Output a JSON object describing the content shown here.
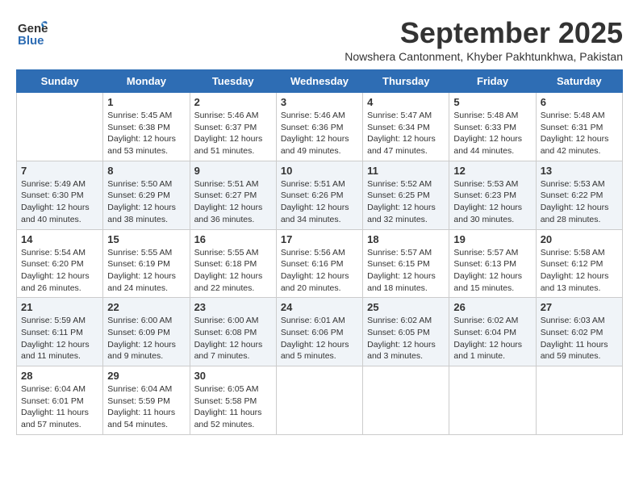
{
  "header": {
    "logo_line1": "General",
    "logo_line2": "Blue",
    "month": "September 2025",
    "location": "Nowshera Cantonment, Khyber Pakhtunkhwa, Pakistan"
  },
  "weekdays": [
    "Sunday",
    "Monday",
    "Tuesday",
    "Wednesday",
    "Thursday",
    "Friday",
    "Saturday"
  ],
  "weeks": [
    [
      {
        "day": "",
        "info": ""
      },
      {
        "day": "1",
        "info": "Sunrise: 5:45 AM\nSunset: 6:38 PM\nDaylight: 12 hours\nand 53 minutes."
      },
      {
        "day": "2",
        "info": "Sunrise: 5:46 AM\nSunset: 6:37 PM\nDaylight: 12 hours\nand 51 minutes."
      },
      {
        "day": "3",
        "info": "Sunrise: 5:46 AM\nSunset: 6:36 PM\nDaylight: 12 hours\nand 49 minutes."
      },
      {
        "day": "4",
        "info": "Sunrise: 5:47 AM\nSunset: 6:34 PM\nDaylight: 12 hours\nand 47 minutes."
      },
      {
        "day": "5",
        "info": "Sunrise: 5:48 AM\nSunset: 6:33 PM\nDaylight: 12 hours\nand 44 minutes."
      },
      {
        "day": "6",
        "info": "Sunrise: 5:48 AM\nSunset: 6:31 PM\nDaylight: 12 hours\nand 42 minutes."
      }
    ],
    [
      {
        "day": "7",
        "info": "Sunrise: 5:49 AM\nSunset: 6:30 PM\nDaylight: 12 hours\nand 40 minutes."
      },
      {
        "day": "8",
        "info": "Sunrise: 5:50 AM\nSunset: 6:29 PM\nDaylight: 12 hours\nand 38 minutes."
      },
      {
        "day": "9",
        "info": "Sunrise: 5:51 AM\nSunset: 6:27 PM\nDaylight: 12 hours\nand 36 minutes."
      },
      {
        "day": "10",
        "info": "Sunrise: 5:51 AM\nSunset: 6:26 PM\nDaylight: 12 hours\nand 34 minutes."
      },
      {
        "day": "11",
        "info": "Sunrise: 5:52 AM\nSunset: 6:25 PM\nDaylight: 12 hours\nand 32 minutes."
      },
      {
        "day": "12",
        "info": "Sunrise: 5:53 AM\nSunset: 6:23 PM\nDaylight: 12 hours\nand 30 minutes."
      },
      {
        "day": "13",
        "info": "Sunrise: 5:53 AM\nSunset: 6:22 PM\nDaylight: 12 hours\nand 28 minutes."
      }
    ],
    [
      {
        "day": "14",
        "info": "Sunrise: 5:54 AM\nSunset: 6:20 PM\nDaylight: 12 hours\nand 26 minutes."
      },
      {
        "day": "15",
        "info": "Sunrise: 5:55 AM\nSunset: 6:19 PM\nDaylight: 12 hours\nand 24 minutes."
      },
      {
        "day": "16",
        "info": "Sunrise: 5:55 AM\nSunset: 6:18 PM\nDaylight: 12 hours\nand 22 minutes."
      },
      {
        "day": "17",
        "info": "Sunrise: 5:56 AM\nSunset: 6:16 PM\nDaylight: 12 hours\nand 20 minutes."
      },
      {
        "day": "18",
        "info": "Sunrise: 5:57 AM\nSunset: 6:15 PM\nDaylight: 12 hours\nand 18 minutes."
      },
      {
        "day": "19",
        "info": "Sunrise: 5:57 AM\nSunset: 6:13 PM\nDaylight: 12 hours\nand 15 minutes."
      },
      {
        "day": "20",
        "info": "Sunrise: 5:58 AM\nSunset: 6:12 PM\nDaylight: 12 hours\nand 13 minutes."
      }
    ],
    [
      {
        "day": "21",
        "info": "Sunrise: 5:59 AM\nSunset: 6:11 PM\nDaylight: 12 hours\nand 11 minutes."
      },
      {
        "day": "22",
        "info": "Sunrise: 6:00 AM\nSunset: 6:09 PM\nDaylight: 12 hours\nand 9 minutes."
      },
      {
        "day": "23",
        "info": "Sunrise: 6:00 AM\nSunset: 6:08 PM\nDaylight: 12 hours\nand 7 minutes."
      },
      {
        "day": "24",
        "info": "Sunrise: 6:01 AM\nSunset: 6:06 PM\nDaylight: 12 hours\nand 5 minutes."
      },
      {
        "day": "25",
        "info": "Sunrise: 6:02 AM\nSunset: 6:05 PM\nDaylight: 12 hours\nand 3 minutes."
      },
      {
        "day": "26",
        "info": "Sunrise: 6:02 AM\nSunset: 6:04 PM\nDaylight: 12 hours\nand 1 minute."
      },
      {
        "day": "27",
        "info": "Sunrise: 6:03 AM\nSunset: 6:02 PM\nDaylight: 11 hours\nand 59 minutes."
      }
    ],
    [
      {
        "day": "28",
        "info": "Sunrise: 6:04 AM\nSunset: 6:01 PM\nDaylight: 11 hours\nand 57 minutes."
      },
      {
        "day": "29",
        "info": "Sunrise: 6:04 AM\nSunset: 5:59 PM\nDaylight: 11 hours\nand 54 minutes."
      },
      {
        "day": "30",
        "info": "Sunrise: 6:05 AM\nSunset: 5:58 PM\nDaylight: 11 hours\nand 52 minutes."
      },
      {
        "day": "",
        "info": ""
      },
      {
        "day": "",
        "info": ""
      },
      {
        "day": "",
        "info": ""
      },
      {
        "day": "",
        "info": ""
      }
    ]
  ]
}
